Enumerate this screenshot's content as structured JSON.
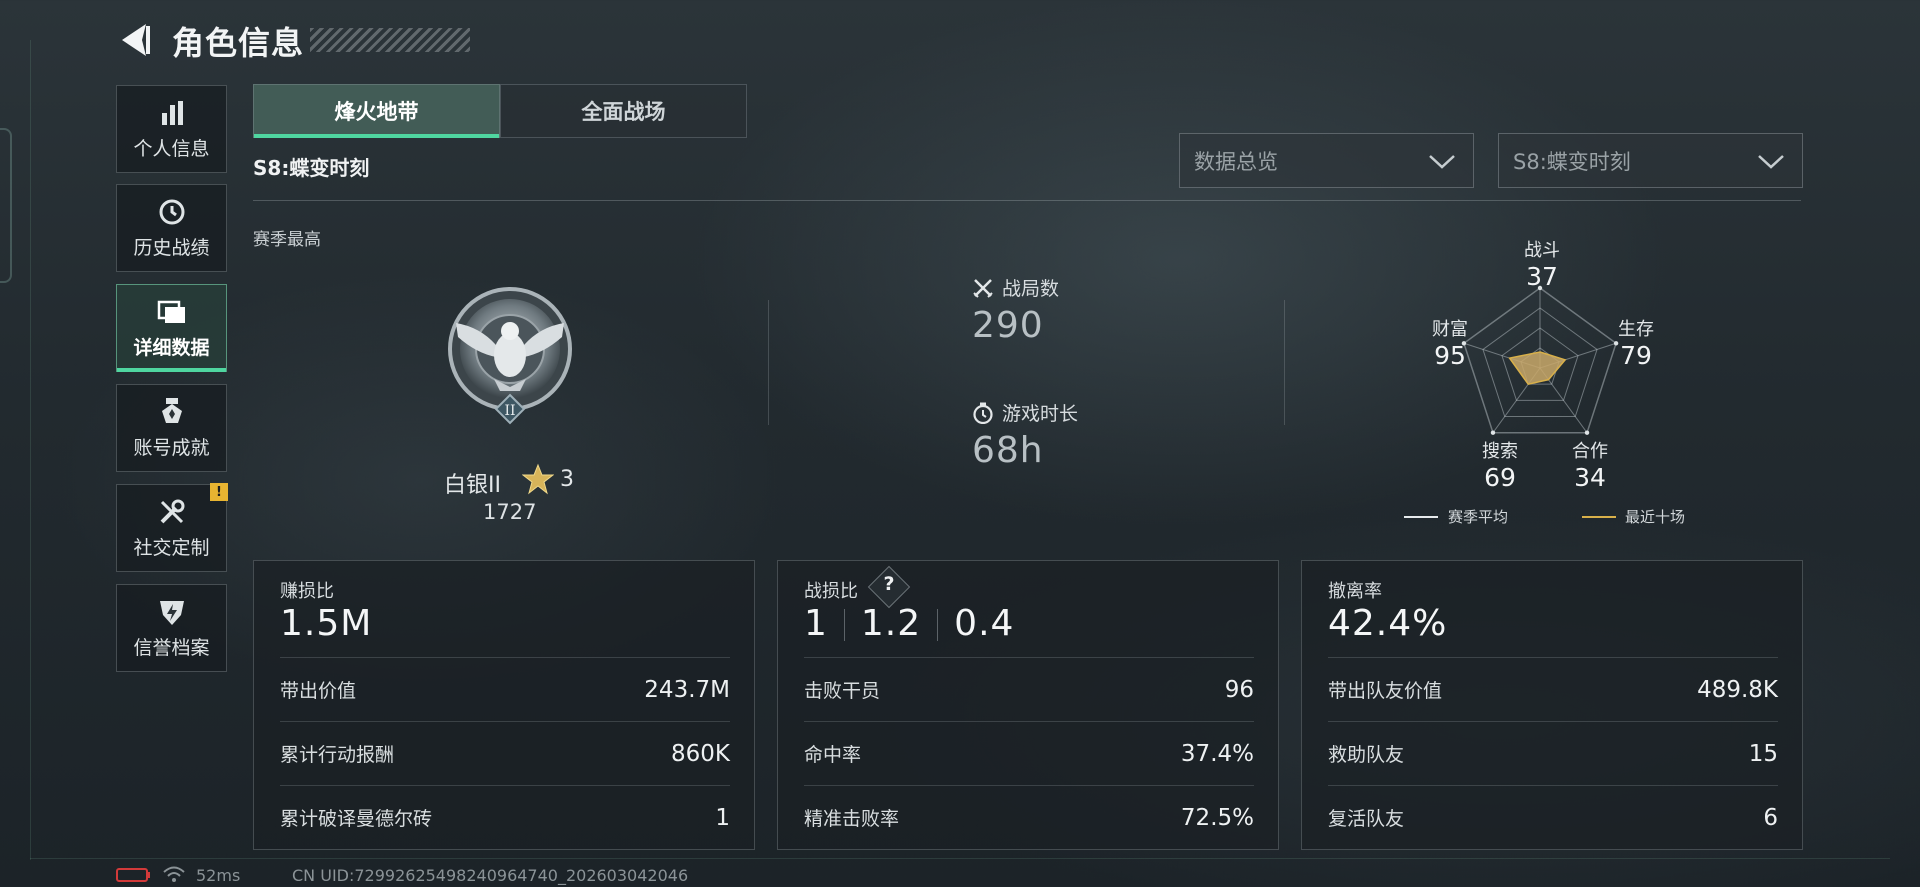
{
  "header": {
    "title": "角色信息"
  },
  "sidebar": {
    "items": [
      {
        "label": "个人信息",
        "icon": "bar-chart-icon"
      },
      {
        "label": "历史战绩",
        "icon": "history-clock-icon"
      },
      {
        "label": "详细数据",
        "icon": "folders-icon",
        "active": true
      },
      {
        "label": "账号成就",
        "icon": "medal-icon"
      },
      {
        "label": "社交定制",
        "icon": "tools-icon",
        "badge": "!"
      },
      {
        "label": "信誉档案",
        "icon": "shield-lightning-icon"
      }
    ]
  },
  "tabs": [
    {
      "label": "烽火地带",
      "active": true
    },
    {
      "label": "全面战场",
      "active": false
    }
  ],
  "season": {
    "title": "S8:蝶变时刻"
  },
  "filters": {
    "view": "数据总览",
    "season": "S8:蝶变时刻"
  },
  "summary": {
    "section_label": "赛季最高",
    "rank_name": "白银II",
    "rank_stars": "3",
    "rank_score": "1727",
    "rank_numeral": "II",
    "matches_label": "战局数",
    "matches_value": "290",
    "playtime_label": "游戏时长",
    "playtime_value": "68h"
  },
  "radar": {
    "axes": [
      {
        "label": "战斗",
        "value": "37"
      },
      {
        "label": "生存",
        "value": "79"
      },
      {
        "label": "合作",
        "value": "34"
      },
      {
        "label": "搜索",
        "value": "69"
      },
      {
        "label": "财富",
        "value": "95"
      }
    ],
    "recent_fraction": [
      0.2,
      0.33,
      0.18,
      0.25,
      0.4
    ],
    "legend": {
      "season_avg": "赛季平均",
      "recent10": "最近十场"
    },
    "colors": {
      "season_avg": "#e6eaec",
      "recent10": "#d8b04a",
      "fill": "#c9a86a"
    }
  },
  "cards": {
    "profit": {
      "label": "赚损比",
      "value": "1.5M",
      "rows": [
        {
          "label": "带出价值",
          "value": "243.7M"
        },
        {
          "label": "累计行动报酬",
          "value": "860K"
        },
        {
          "label": "累计破译曼德尔砖",
          "value": "1"
        }
      ]
    },
    "combat": {
      "label": "战损比",
      "help": "?",
      "kd": [
        "1",
        "1.2",
        "0.4"
      ],
      "rows": [
        {
          "label": "击败干员",
          "value": "96"
        },
        {
          "label": "命中率",
          "value": "37.4%"
        },
        {
          "label": "精准击败率",
          "value": "72.5%"
        }
      ]
    },
    "extract": {
      "label": "撤离率",
      "value": "42.4%",
      "rows": [
        {
          "label": "带出队友价值",
          "value": "489.8K"
        },
        {
          "label": "救助队友",
          "value": "15"
        },
        {
          "label": "复活队友",
          "value": "6"
        }
      ]
    }
  },
  "status_bar": {
    "ping": "52ms",
    "uid": "CN UID:72992625498240964740_202603042046"
  }
}
